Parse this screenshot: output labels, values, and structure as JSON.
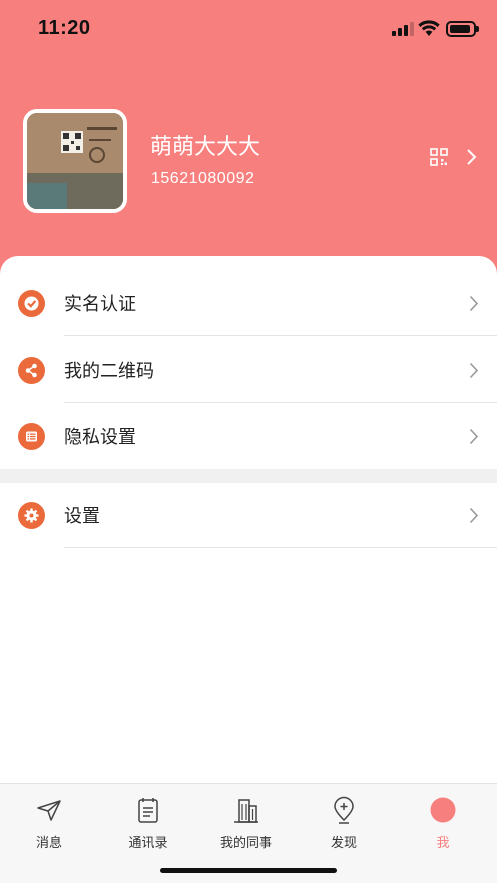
{
  "status_bar": {
    "time": "11:20"
  },
  "profile": {
    "name": "萌萌大大大",
    "phone": "15621080092",
    "qr_icon": "qr-code-icon",
    "chevron_icon": "chevron-right-icon"
  },
  "menu": {
    "items": [
      {
        "label": "实名认证",
        "icon": "check-circle-icon"
      },
      {
        "label": "我的二维码",
        "icon": "share-icon"
      },
      {
        "label": "隐私设置",
        "icon": "list-icon"
      },
      {
        "label": "设置",
        "icon": "gear-icon"
      }
    ]
  },
  "tabbar": {
    "tabs": [
      {
        "label": "消息",
        "icon": "paper-plane-icon"
      },
      {
        "label": "通讯录",
        "icon": "contacts-book-icon"
      },
      {
        "label": "我的同事",
        "icon": "building-icon"
      },
      {
        "label": "发现",
        "icon": "location-plus-icon"
      },
      {
        "label": "我",
        "icon": "profile-dot-icon",
        "active": true
      }
    ]
  },
  "colors": {
    "header_bg": "#f7807f",
    "menu_icon": "#ea6a3c",
    "active_tab": "#f7807f"
  }
}
